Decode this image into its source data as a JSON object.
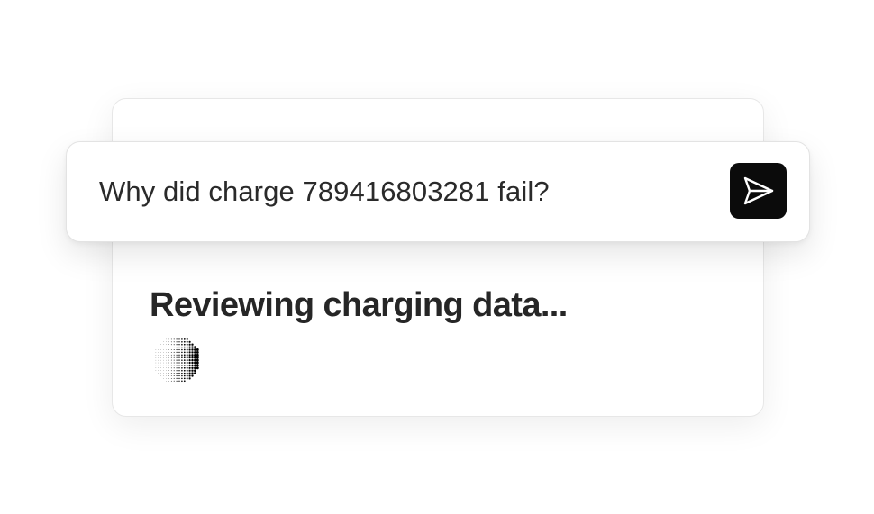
{
  "prompt": {
    "text": "Why did charge 789416803281 fail?"
  },
  "send_button": {
    "icon": "send-icon"
  },
  "status": {
    "text": "Reviewing charging data..."
  },
  "loader": {
    "icon": "halftone-spinner-icon"
  },
  "colors": {
    "send_button_bg": "#0b0b0b",
    "text": "#2a2a2a",
    "card_border": "#e5e5e5"
  }
}
